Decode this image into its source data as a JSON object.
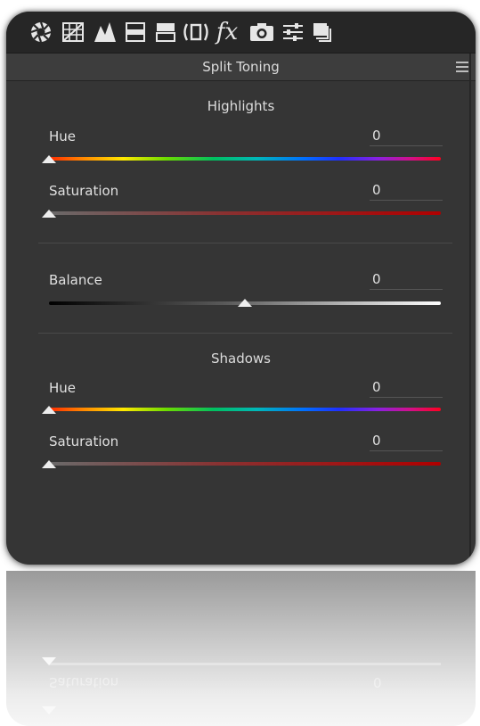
{
  "toolbar": {
    "icons": [
      "basic-aperture-icon",
      "tone-curve-icon",
      "detail-icon",
      "hsl-icon",
      "split-toning-icon",
      "lens-corrections-icon",
      "effects-fx-icon",
      "camera-calibration-icon",
      "presets-sliders-icon",
      "snapshots-icon"
    ],
    "fx_label": "fx",
    "active": "split-toning-icon"
  },
  "panel": {
    "title": "Split Toning"
  },
  "highlights": {
    "title": "Highlights",
    "hue": {
      "label": "Hue",
      "value": "0",
      "position": 0
    },
    "saturation": {
      "label": "Saturation",
      "value": "0",
      "position": 0
    }
  },
  "balance": {
    "label": "Balance",
    "value": "0",
    "position": 0.5
  },
  "shadows": {
    "title": "Shadows",
    "hue": {
      "label": "Hue",
      "value": "0",
      "position": 0
    },
    "saturation": {
      "label": "Saturation",
      "value": "0",
      "position": 0
    }
  },
  "colors": {
    "panel_bg": "#353535",
    "toolbar_bg": "#262626",
    "text": "#e0e0e0"
  }
}
